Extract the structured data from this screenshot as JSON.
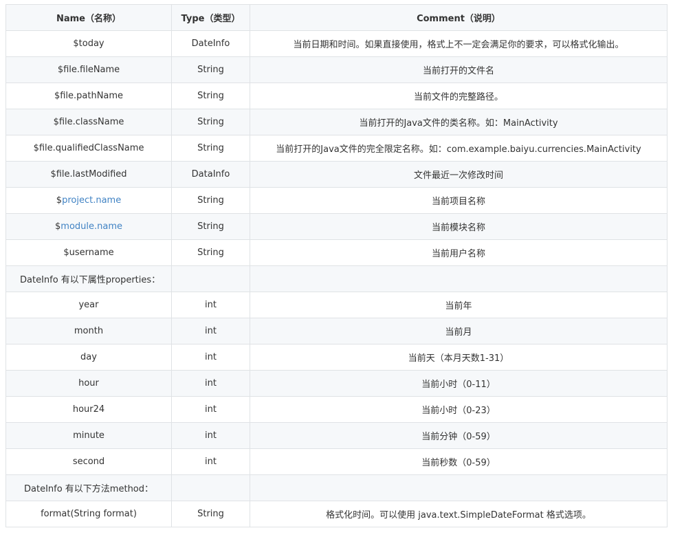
{
  "headers": {
    "name": "Name（名称）",
    "type": "Type（类型）",
    "comment": "Comment（说明）"
  },
  "rows": [
    {
      "name": "$today",
      "type": "DateInfo",
      "comment": "当前日期和时间。如果直接使用，格式上不一定会满足你的要求，可以格式化输出。"
    },
    {
      "name": "$file.fileName",
      "type": "String",
      "comment": "当前打开的文件名"
    },
    {
      "name": "$file.pathName",
      "type": "String",
      "comment": "当前文件的完整路径。"
    },
    {
      "name": "$file.className",
      "type": "String",
      "comment": "当前打开的Java文件的类名称。如：MainActivity"
    },
    {
      "name": "$file.qualifiedClassName",
      "type": "String",
      "comment": "当前打开的Java文件的完全限定名称。如：com.example.baiyu.currencies.MainActivity"
    },
    {
      "name": "$file.lastModified",
      "type": "DataInfo",
      "comment": "文件最近一次修改时间"
    },
    {
      "name_prefix": "$",
      "name_link": "project.name",
      "type": "String",
      "comment": "当前项目名称"
    },
    {
      "name_prefix": "$",
      "name_link": "module.name",
      "type": "String",
      "comment": "当前模块名称"
    },
    {
      "name": "$username",
      "type": "String",
      "comment": "当前用户名称"
    }
  ],
  "section_properties": "DateInfo 有以下属性properties：",
  "properties": [
    {
      "name": "year",
      "type": "int",
      "comment": "当前年"
    },
    {
      "name": "month",
      "type": "int",
      "comment": "当前月"
    },
    {
      "name": "day",
      "type": "int",
      "comment": "当前天（本月天数1-31）"
    },
    {
      "name": "hour",
      "type": "int",
      "comment": "当前小时（0-11）"
    },
    {
      "name": "hour24",
      "type": "int",
      "comment": "当前小时（0-23）"
    },
    {
      "name": "minute",
      "type": "int",
      "comment": "当前分钟（0-59）"
    },
    {
      "name": "second",
      "type": "int",
      "comment": "当前秒数（0-59）"
    }
  ],
  "section_methods": "DateInfo 有以下方法method：",
  "methods": [
    {
      "name": "format(String format)",
      "type": "String",
      "comment": "格式化时间。可以使用 java.text.SimpleDateFormat 格式选项。"
    }
  ],
  "colors": {
    "border": "#dfe2e5",
    "stripe": "#f6f8fa",
    "text": "#333333",
    "link": "#4183c4"
  }
}
